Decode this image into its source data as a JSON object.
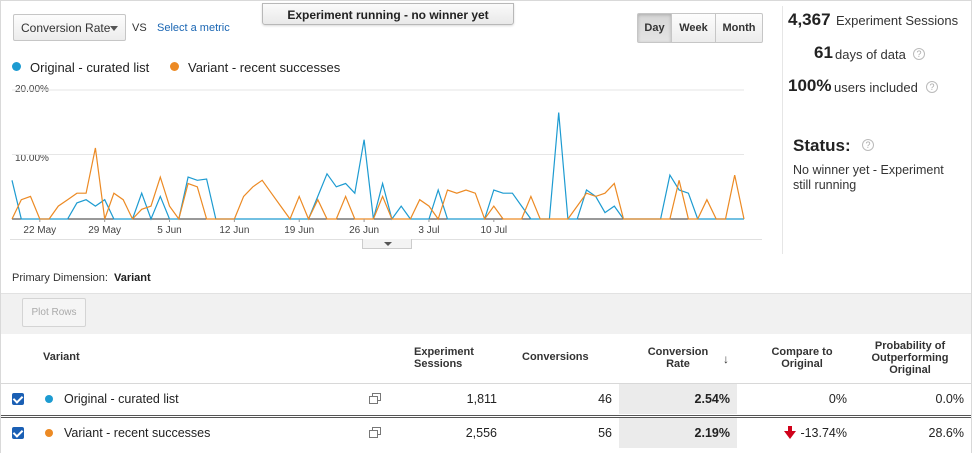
{
  "controls": {
    "metric_select": "Conversion Rate",
    "vs": "VS",
    "select_metric_link": "Select a metric",
    "banner": "Experiment running - no winner yet",
    "period_tabs": [
      "Day",
      "Week",
      "Month"
    ],
    "active_period": "Day"
  },
  "legend": [
    {
      "label": "Original - curated list",
      "color": "#1d9bd1"
    },
    {
      "label": "Variant - recent successes",
      "color": "#ec8a24"
    }
  ],
  "stats": {
    "sessions_value": "4,367",
    "sessions_label": "Experiment Sessions",
    "days_value": "61",
    "days_label": "days of data",
    "users_value": "100%",
    "users_label": "users included",
    "status_title": "Status:",
    "status_text": "No winner yet - Experiment still running"
  },
  "chart_data": {
    "type": "line",
    "y_tick_labels": [
      "20.00%",
      "10.00%"
    ],
    "ylim": [
      0,
      20
    ],
    "x_tick_labels": [
      "22 May",
      "29 May",
      "5 Jun",
      "12 Jun",
      "19 Jun",
      "26 Jun",
      "3 Jul",
      "10 Jul"
    ],
    "x_start": "2016-05-19",
    "series": [
      {
        "name": "Original - curated list",
        "color": "#1d9bd1",
        "values": [
          6.0,
          0,
          0,
          0,
          0,
          0,
          0,
          2.5,
          3.0,
          2.0,
          3.0,
          0,
          0,
          0,
          4.0,
          0,
          3.5,
          0,
          0,
          6.5,
          6.0,
          6.2,
          0,
          0,
          0,
          0,
          0,
          0,
          0,
          0,
          0,
          0,
          0,
          3.5,
          7.0,
          5.0,
          5.5,
          4.0,
          12.3,
          0,
          5.5,
          0,
          2.0,
          0,
          0,
          0,
          4.5,
          0,
          0,
          0,
          0,
          0,
          4.5,
          4.0,
          4.0,
          2.0,
          0,
          0,
          0,
          16.5,
          0,
          0,
          4.5,
          3.5,
          1.0,
          2.0,
          0,
          0,
          0,
          0,
          0,
          6.8,
          4.5,
          4.0,
          0,
          0,
          0,
          0,
          0,
          0
        ]
      },
      {
        "name": "Variant - recent successes",
        "color": "#ec8a24",
        "values": [
          0,
          3.0,
          3.5,
          0,
          0,
          2.0,
          3.0,
          4.0,
          4.0,
          11.0,
          0,
          4.0,
          3.0,
          0,
          1.5,
          2.0,
          6.5,
          2.0,
          0,
          5.5,
          5.0,
          0,
          0,
          0,
          0,
          3.5,
          5.0,
          6.0,
          4.0,
          2.0,
          0,
          3.5,
          0,
          3.0,
          0,
          0,
          3.5,
          0,
          0,
          0,
          3.5,
          0,
          0,
          0,
          3.0,
          2.0,
          0,
          4.5,
          4.0,
          4.5,
          4.0,
          0,
          2.0,
          0,
          0,
          0,
          3.5,
          0,
          0,
          0,
          0,
          2.0,
          4.0,
          3.5,
          4.0,
          5.5,
          0,
          0,
          0,
          0,
          0,
          0,
          6.0,
          0,
          0,
          3.0,
          0,
          0,
          6.8,
          0
        ]
      }
    ]
  },
  "primary_dimension": {
    "label": "Primary Dimension:",
    "value": "Variant"
  },
  "plot_rows_label": "Plot Rows",
  "table": {
    "headers": {
      "variant": "Variant",
      "sessions": "Experiment Sessions",
      "conversions": "Conversions",
      "rate": "Conversion Rate",
      "compare": "Compare to Original",
      "probability": "Probability of Outperforming Original"
    },
    "rows": [
      {
        "name": "Original - curated list",
        "color": "#1d9bd1",
        "sessions": "1,811",
        "conversions": "46",
        "rate": "2.54%",
        "compare": "0%",
        "probability": "0.0%"
      },
      {
        "name": "Variant - recent successes",
        "color": "#ec8a24",
        "sessions": "2,556",
        "conversions": "56",
        "rate": "2.19%",
        "compare": "-13.74%",
        "probability": "28.6%"
      }
    ]
  }
}
